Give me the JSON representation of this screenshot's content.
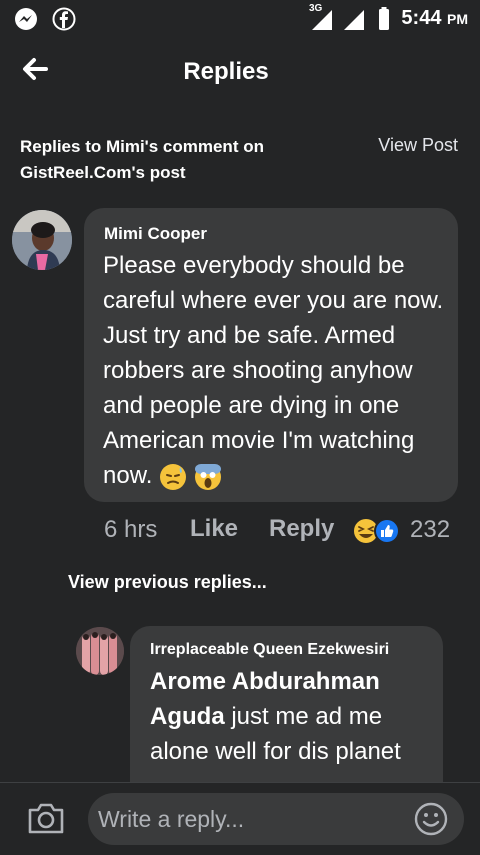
{
  "status_bar": {
    "network": "3G",
    "time": "5:44",
    "ampm": "PM",
    "icons": [
      "messenger-icon",
      "facebook-icon",
      "signal-icon",
      "battery-icon"
    ]
  },
  "header": {
    "title": "Replies",
    "back_icon": "back-arrow-icon"
  },
  "context": {
    "text": "Replies to Mimi's comment on GistReel.Com's post",
    "view_post_label": "View Post"
  },
  "main_comment": {
    "author": "Mimi Cooper",
    "text": "Please everybody should be careful where ever you are now. Just try and be safe. Armed robbers are shooting anyhow and people are dying in one American movie I'm watching now.",
    "emojis": [
      "sweat-emoji",
      "scream-emoji"
    ],
    "time": "6 hrs",
    "like_label": "Like",
    "reply_label": "Reply",
    "reactions": [
      "haha-reaction",
      "like-reaction"
    ],
    "reaction_count": "232"
  },
  "view_previous_label": "View previous replies...",
  "reply": {
    "author": "Irreplaceable Queen Ezekwesiri",
    "mention": "Arome Abdurahman Aguda",
    "text": " just me ad me alone well for dis planet"
  },
  "composer": {
    "placeholder": "Write a reply...",
    "camera_icon": "camera-icon",
    "emoji_icon": "smiley-icon"
  },
  "colors": {
    "background": "#242526",
    "bubble": "#3a3b3c",
    "text": "#ffffff",
    "secondary_text": "#b0b3b8"
  }
}
